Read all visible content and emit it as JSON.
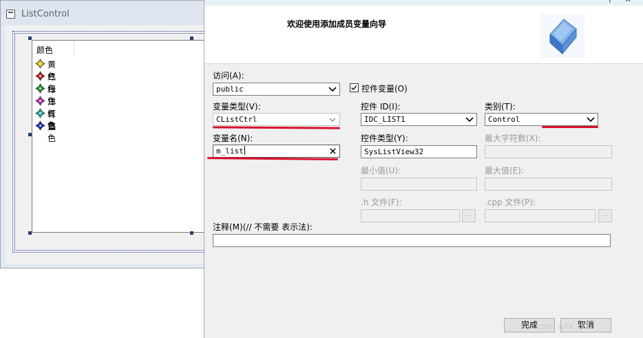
{
  "background_window": {
    "title": "ListControl",
    "list_header": "颜色",
    "items": [
      {
        "label": "黄色",
        "color": "#d4c400"
      },
      {
        "label": "红色",
        "color": "#c41a1a"
      },
      {
        "label": "绿色",
        "color": "#1a9a2a"
      },
      {
        "label": "洋红色",
        "color": "#b82ab8"
      },
      {
        "label": "青色",
        "color": "#1aa8b0"
      },
      {
        "label": "蓝色",
        "color": "#1a2ab8"
      }
    ]
  },
  "dialog": {
    "heading": "欢迎使用添加成员变量向导",
    "access": {
      "label": "访问(A):",
      "value": "public"
    },
    "control_variable": {
      "label": "控件变量(O)",
      "checked": true
    },
    "var_type": {
      "label": "变量类型(V):",
      "value": "CListCtrl"
    },
    "control_id": {
      "label": "控件 ID(I):",
      "value": "IDC_LIST1"
    },
    "category": {
      "label": "类别(T):",
      "value": "Control"
    },
    "var_name": {
      "label": "变量名(N):",
      "value": "m_list"
    },
    "control_type": {
      "label": "控件类型(Y):",
      "value": "SysListView32"
    },
    "max_chars": {
      "label": "最大字符数(X):"
    },
    "min_value": {
      "label": "最小值(U):"
    },
    "max_value": {
      "label": "最大值(E):"
    },
    "h_file": {
      "label": ".h 文件(F):",
      "browse": "..."
    },
    "cpp_file": {
      "label": ".cpp 文件(P):",
      "browse": "..."
    },
    "comment": {
      "label": "注释(M)(// 不需要 表示法):",
      "value": ""
    },
    "finish_label": "完成",
    "cancel_label": "取消"
  },
  "watermark": "CSDN @TX_TYX",
  "colors": {
    "accent_underline": "#d8102b"
  }
}
